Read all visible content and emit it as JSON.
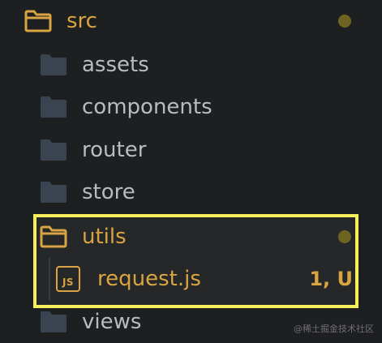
{
  "colors": {
    "background": "#1e1f20",
    "folder_icon": "#3a4350",
    "folder_label": "#b8bcc2",
    "modified": "#d9a441",
    "dot": "#6e6422",
    "highlight_border": "#f5ef5a"
  },
  "tree": {
    "root": {
      "name": "src",
      "icon": "folder-outline-icon",
      "modified": true
    },
    "children": [
      {
        "name": "assets",
        "icon": "folder-icon"
      },
      {
        "name": "components",
        "icon": "folder-icon"
      },
      {
        "name": "router",
        "icon": "folder-icon"
      },
      {
        "name": "store",
        "icon": "folder-icon"
      },
      {
        "name": "utils",
        "icon": "folder-outline-icon",
        "modified": true,
        "expanded": true
      },
      {
        "name": "views",
        "icon": "folder-icon"
      }
    ],
    "utils_file": {
      "name": "request.js",
      "icon_text": "JS",
      "status": "1, U"
    }
  },
  "watermark": "@稀土掘金技术社区"
}
